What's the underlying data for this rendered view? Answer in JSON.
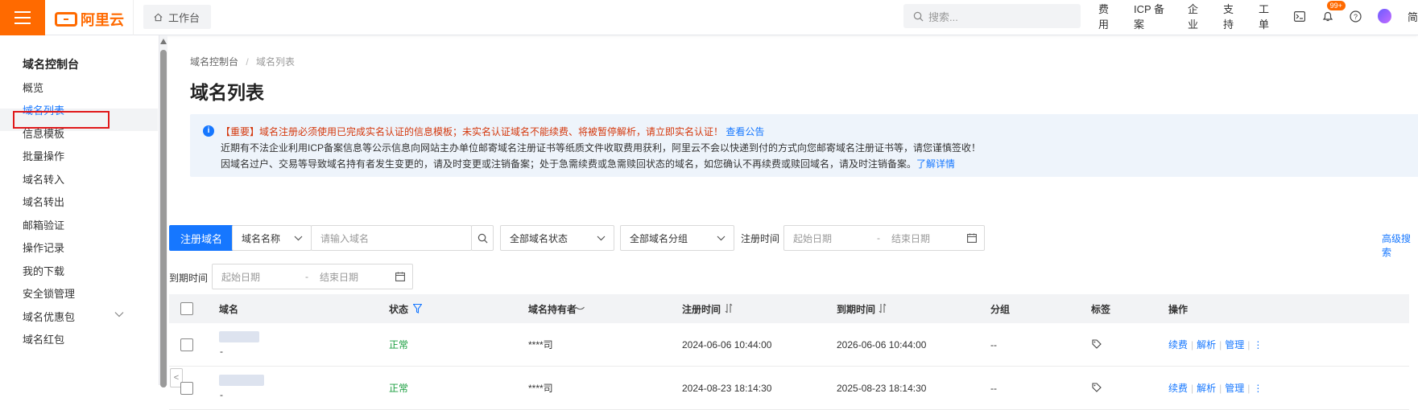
{
  "topbar": {
    "logo_text": "阿里云",
    "workbench": "工作台",
    "search_placeholder": "搜索...",
    "nav": [
      "费用",
      "ICP 备案",
      "企业",
      "支持",
      "工单"
    ],
    "bell_badge": "99+",
    "user_initial": "简",
    "brand_color": "#ff6a00"
  },
  "sidebar": {
    "title": "域名控制台",
    "items": [
      {
        "label": "概览"
      },
      {
        "label": "域名列表",
        "active": true
      },
      {
        "label": "信息模板"
      },
      {
        "label": "批量操作"
      },
      {
        "label": "域名转入"
      },
      {
        "label": "域名转出"
      },
      {
        "label": "邮箱验证"
      },
      {
        "label": "操作记录"
      },
      {
        "label": "我的下载"
      },
      {
        "label": "安全锁管理"
      },
      {
        "label": "域名优惠包"
      },
      {
        "label": "域名红包"
      }
    ]
  },
  "breadcrumb": {
    "root": "域名控制台",
    "sep": "/",
    "current": "域名列表"
  },
  "page_title": "域名列表",
  "notice": {
    "line1": "【重要】域名注册必须使用已完成实名认证的信息模板；未实名认证域名不能续费、将被暂停解析，请立即实名认证！",
    "line1_link": "查看公告",
    "line2": "近期有不法企业利用ICP备案信息等公示信息向网站主办单位邮寄域名注册证书等纸质文件收取费用获利，阿里云不会以快递到付的方式向您邮寄域名注册证书等，请您谨慎签收！",
    "line3": "因域名过户、交易等导致域名持有者发生变更的，请及时变更或注销备案；处于急需续费或急需赎回状态的域名，如您确认不再续费或赎回域名，请及时注销备案。",
    "line3_link": "了解详情"
  },
  "filters": {
    "register_button": "注册域名",
    "field_select": "域名名称",
    "domain_placeholder": "请输入域名",
    "status_select": "全部域名状态",
    "group_select": "全部域名分组",
    "reg_time_label": "注册时间",
    "start_placeholder": "起始日期",
    "date_sep": "-",
    "end_placeholder": "结束日期",
    "expire_label": "到期时间",
    "advanced": "高级搜索"
  },
  "table": {
    "headers": {
      "domain": "域名",
      "status": "状态",
      "owner": "域名持有者",
      "reg_time": "注册时间",
      "expire_time": "到期时间",
      "group": "分组",
      "tags": "标签",
      "actions": "操作"
    },
    "rows": [
      {
        "domain_suffix": "-",
        "status": "正常",
        "owner": "****司",
        "reg_time": "2024-06-06 10:44:00",
        "expire_time": "2026-06-06 10:44:00",
        "group": "--"
      },
      {
        "domain_suffix": "-",
        "status": "正常",
        "owner": "****司",
        "reg_time": "2024-08-23 18:14:30",
        "expire_time": "2025-08-23 18:14:30",
        "group": "--"
      }
    ],
    "row_actions": [
      "续费",
      "解析",
      "管理"
    ],
    "row_actions_sep": "|"
  }
}
